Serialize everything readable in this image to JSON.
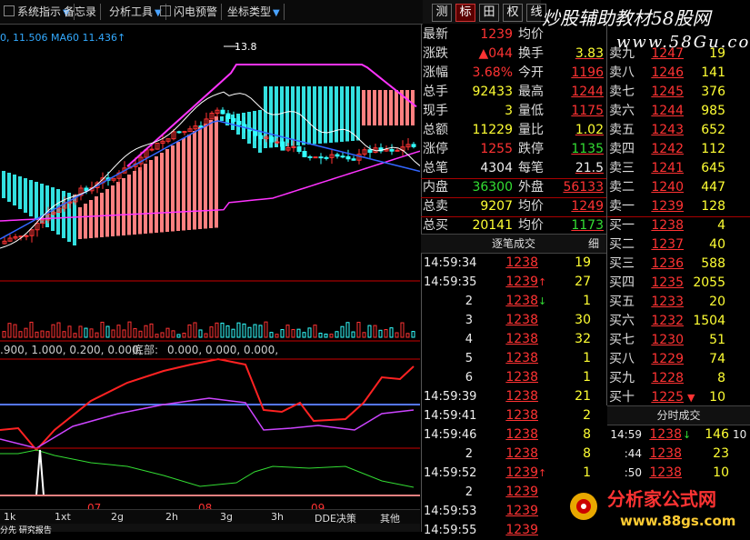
{
  "toolbar": {
    "buttons": [
      {
        "label": "系统指示",
        "dropdown": true,
        "check": true
      },
      {
        "label": "备忘录",
        "dropdown": false,
        "check": false
      },
      {
        "label": "分析工具",
        "dropdown": true,
        "check": false
      },
      {
        "label": "闪电预警",
        "dropdown": false,
        "check": true
      },
      {
        "label": "坐标类型",
        "dropdown": true,
        "check": false
      }
    ],
    "right_tabs": [
      "测",
      "标",
      "田",
      "权",
      "线"
    ],
    "active_tab": 3
  },
  "watermark": {
    "text": "炒股辅助教材58股网",
    "url": "www.58Gu.com"
  },
  "chart_header": {
    "ma_text": "0, 11.506   MA60  11.436↑",
    "peak_label": "13.8",
    "indicator_params": ".900, 1.000, 0.200, 0.000,",
    "indicator_name": "底部:",
    "indicator_values": "0.000, 0.000, 0.000,",
    "month_labels": [
      "07",
      "08",
      "09"
    ]
  },
  "bottom_tabs": [
    "1k",
    "1xt",
    "2g",
    "2h",
    "3g",
    "3h",
    "DDE决策",
    "其他"
  ],
  "bottom_strip": "分先  研究报告",
  "quote": {
    "rows": [
      {
        "l1": "最新",
        "v1": "1239",
        "c1": "red",
        "l2": "均价",
        "v2": "",
        "c2": "red"
      },
      {
        "l1": "涨跌",
        "v1": "▲044",
        "c1": "red",
        "l2": "换手",
        "v2": "3.83",
        "c2": "yellow"
      },
      {
        "l1": "涨幅",
        "v1": "3.68%",
        "c1": "red",
        "l2": "今开",
        "v2": "1196",
        "c2": "red"
      },
      {
        "l1": "总手",
        "v1": "92433",
        "c1": "yellow",
        "l2": "最高",
        "v2": "1244",
        "c2": "red"
      },
      {
        "l1": "现手",
        "v1": "3",
        "c1": "yellow",
        "l2": "量低",
        "v2": "1175",
        "c2": "red"
      },
      {
        "l1": "总额",
        "v1": "11229",
        "c1": "yellow",
        "l2": "量比",
        "v2": "1.02",
        "c2": "yellow"
      },
      {
        "l1": "涨停",
        "v1": "1255",
        "c1": "red",
        "l2": "跌停",
        "v2": "1135",
        "c2": "green"
      },
      {
        "l1": "总笔",
        "v1": "4304",
        "c1": "white",
        "l2": "每笔",
        "v2": "21.5",
        "c2": "white"
      },
      {
        "l1": "内盘",
        "v1": "36300",
        "c1": "green",
        "l2": "外盘",
        "v2": "56133",
        "c2": "red"
      },
      {
        "l1": "总卖",
        "v1": "9207",
        "c1": "yellow",
        "l2": "均价",
        "v2": "1249",
        "c2": "red"
      },
      {
        "l1": "总买",
        "v1": "20141",
        "c1": "yellow",
        "l2": "均价",
        "v2": "1173",
        "c2": "green"
      }
    ],
    "sell_levels": [
      {
        "label": "卖九",
        "price": "1247",
        "vol": "19"
      },
      {
        "label": "卖八",
        "price": "1246",
        "vol": "141"
      },
      {
        "label": "卖七",
        "price": "1245",
        "vol": "376"
      },
      {
        "label": "卖六",
        "price": "1244",
        "vol": "985"
      },
      {
        "label": "卖五",
        "price": "1243",
        "vol": "652"
      },
      {
        "label": "卖四",
        "price": "1242",
        "vol": "112"
      },
      {
        "label": "卖三",
        "price": "1241",
        "vol": "645"
      },
      {
        "label": "卖二",
        "price": "1240",
        "vol": "447"
      },
      {
        "label": "卖一",
        "price": "1239",
        "vol": "128"
      }
    ],
    "buy_levels": [
      {
        "label": "买一",
        "price": "1238",
        "vol": "4",
        "mark": ""
      },
      {
        "label": "买二",
        "price": "1237",
        "vol": "40",
        "mark": ""
      },
      {
        "label": "买三",
        "price": "1236",
        "vol": "588",
        "mark": ""
      },
      {
        "label": "买四",
        "price": "1235",
        "vol": "2055",
        "mark": ""
      },
      {
        "label": "买五",
        "price": "1233",
        "vol": "20",
        "mark": ""
      },
      {
        "label": "买六",
        "price": "1232",
        "vol": "1504",
        "mark": ""
      },
      {
        "label": "买七",
        "price": "1230",
        "vol": "51",
        "mark": ""
      },
      {
        "label": "买八",
        "price": "1229",
        "vol": "74",
        "mark": ""
      },
      {
        "label": "买九",
        "price": "1228",
        "vol": "8",
        "mark": ""
      },
      {
        "label": "买十",
        "price": "1225",
        "vol": "10",
        "mark": "▼"
      }
    ]
  },
  "ticks": {
    "title": "逐笔成交",
    "detail": "细",
    "rows": [
      {
        "time": "14:59:34",
        "price": "1238",
        "arrow": "",
        "vol": "19"
      },
      {
        "time": "14:59:35",
        "price": "1239",
        "arrow": "up",
        "vol": "27"
      },
      {
        "time": "2",
        "price": "1238",
        "arrow": "down",
        "vol": "1"
      },
      {
        "time": "3",
        "price": "1238",
        "arrow": "",
        "vol": "30"
      },
      {
        "time": "4",
        "price": "1238",
        "arrow": "",
        "vol": "32"
      },
      {
        "time": "5",
        "price": "1238",
        "arrow": "",
        "vol": "1"
      },
      {
        "time": "6",
        "price": "1238",
        "arrow": "",
        "vol": "1"
      },
      {
        "time": "14:59:39",
        "price": "1238",
        "arrow": "",
        "vol": "21"
      },
      {
        "time": "14:59:41",
        "price": "1238",
        "arrow": "",
        "vol": "2"
      },
      {
        "time": "14:59:46",
        "price": "1238",
        "arrow": "",
        "vol": "8"
      },
      {
        "time": "2",
        "price": "1238",
        "arrow": "",
        "vol": "8"
      },
      {
        "time": "14:59:52",
        "price": "1239",
        "arrow": "up",
        "vol": "1"
      },
      {
        "time": "2",
        "price": "1239",
        "arrow": "",
        "vol": "2"
      },
      {
        "time": "14:59:53",
        "price": "1239",
        "arrow": "",
        "vol": "2"
      },
      {
        "time": "14:59:55",
        "price": "1239",
        "arrow": "",
        "vol": ""
      }
    ]
  },
  "minute_trades": {
    "title": "分时成交",
    "rows": [
      {
        "time": "14:59",
        "price": "1238",
        "arrow": "down",
        "vol": "146",
        "extra": "10"
      },
      {
        "time": ":44",
        "price": "1238",
        "arrow": "",
        "vol": "23",
        "extra": ""
      },
      {
        "time": ":50",
        "price": "1238",
        "arrow": "",
        "vol": "10",
        "extra": ""
      }
    ]
  },
  "logo": {
    "title": "分析家公式网",
    "url": "www.88gs.com"
  },
  "colors": {
    "up": "#ff3333",
    "down": "#33dd33",
    "cloud_up": "#ff8080",
    "cloud_down": "#33e0e0",
    "ma_magenta": "#ff33ff"
  },
  "icons": {
    "check": "checkbox-icon",
    "dropdown": "triangle-down-icon",
    "up_arrow": "arrow-up-icon",
    "down_arrow": "arrow-down-icon"
  }
}
